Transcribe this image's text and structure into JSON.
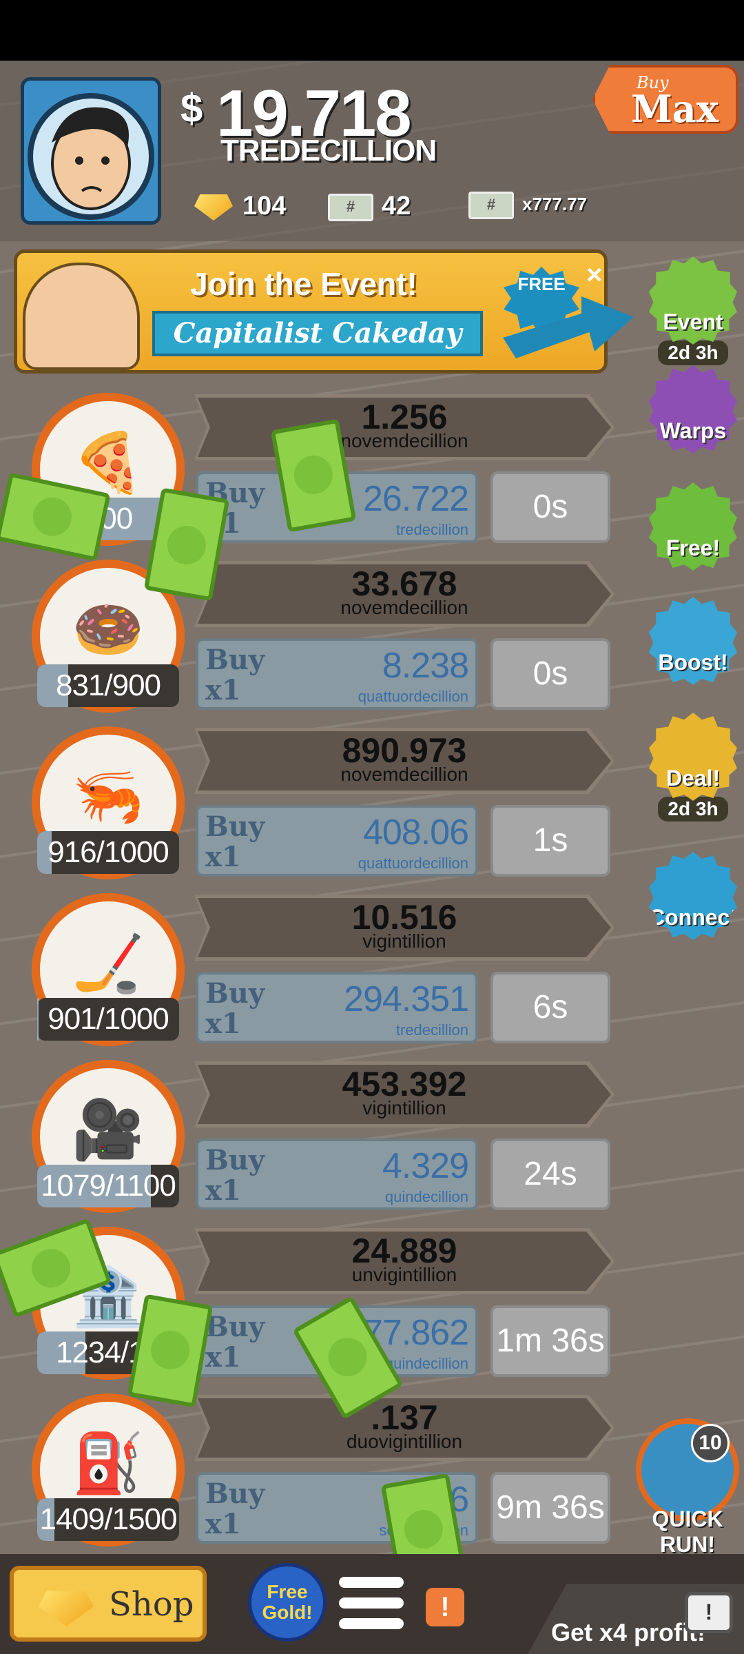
{
  "header": {
    "money_symbol": "$",
    "money_amount": "19.718",
    "money_unit": "TREDECILLION",
    "gold": "104",
    "megabucks": "42",
    "multiplier": "x777.77",
    "buy_mode_small": "Buy",
    "buy_mode_big": "Max"
  },
  "event_banner": {
    "title": "Join the Event!",
    "subtitle": "Capitalist Cakeday",
    "free_label": "FREE",
    "close": "×"
  },
  "side_buttons": [
    {
      "label": "Event",
      "sub": "2d 3h",
      "color": "#7cc243",
      "icon": "cake-icon"
    },
    {
      "label": "Warps",
      "top": "2",
      "color": "#8e4fb5",
      "icon": "warp-icon"
    },
    {
      "label": "Free!",
      "color": "#6fbd3c",
      "icon": "tv-icon"
    },
    {
      "label": "Boost!",
      "color": "#3aa6d6",
      "icon": "car-icon"
    },
    {
      "label": "Deal!",
      "sub": "2d 3h",
      "color": "#e7b52e",
      "icon": "gift-icon"
    },
    {
      "label": "Connect",
      "color": "#2f9fd2",
      "icon": "cards-icon"
    }
  ],
  "businesses": [
    {
      "icon": "🍕",
      "icon_name": "pizza-icon",
      "owned": "800",
      "owned_fraction": 0.9,
      "profit": "1.256",
      "profit_unit": "novemdecillion",
      "buy_label": "Buy",
      "buy_qty": "x1",
      "cost": "26.722",
      "cost_unit": "tredecillion",
      "timer": "0s"
    },
    {
      "icon": "🍩",
      "icon_name": "donut-icon",
      "owned": "831/900",
      "owned_fraction": 0.22,
      "profit": "33.678",
      "profit_unit": "novemdecillion",
      "buy_label": "Buy",
      "buy_qty": "x1",
      "cost": "8.238",
      "cost_unit": "quattuordecillion",
      "timer": "0s"
    },
    {
      "icon": "🦐",
      "icon_name": "shrimp-icon",
      "owned": "916/1000",
      "owned_fraction": 0.1,
      "profit": "890.973",
      "profit_unit": "novemdecillion",
      "buy_label": "Buy",
      "buy_qty": "x1",
      "cost": "408.06",
      "cost_unit": "quattuordecillion",
      "timer": "1s"
    },
    {
      "icon": "🏒",
      "icon_name": "hockey-icon",
      "owned": "901/1000",
      "owned_fraction": 0.01,
      "profit": "10.516",
      "profit_unit": "vigintillion",
      "buy_label": "Buy",
      "buy_qty": "x1",
      "cost": "294.351",
      "cost_unit": "tredecillion",
      "timer": "6s"
    },
    {
      "icon": "🎥",
      "icon_name": "movie-camera-icon",
      "owned": "1079/1100",
      "owned_fraction": 0.8,
      "profit": "453.392",
      "profit_unit": "vigintillion",
      "buy_label": "Buy",
      "buy_qty": "x1",
      "cost": "4.329",
      "cost_unit": "quindecillion",
      "timer": "24s"
    },
    {
      "icon": "🏦",
      "icon_name": "bank-icon",
      "owned": "1234/13",
      "owned_fraction": 0.34,
      "profit": "24.889",
      "profit_unit": "unvigintillion",
      "buy_label": "Buy",
      "buy_qty": "x1",
      "cost": "377.862",
      "cost_unit": "quindecillion",
      "timer": "1m 36s"
    },
    {
      "icon": "⛽",
      "icon_name": "oil-rig-icon",
      "owned": "1409/1500",
      "owned_fraction": 0.12,
      "profit": ".137",
      "profit_unit": "duovigintillion",
      "buy_label": "Buy",
      "buy_qty": "x1",
      "cost": "6.506",
      "cost_unit": "sexvigintillion",
      "timer": "9m 36s"
    }
  ],
  "quick_run": {
    "count": "10",
    "label": "QUICK RUN!"
  },
  "bottom": {
    "shop": "Shop",
    "free_gold_1": "Free",
    "free_gold_2": "Gold!",
    "alert": "!",
    "x4_profit": "Get x4 profit!",
    "tv": "!"
  }
}
